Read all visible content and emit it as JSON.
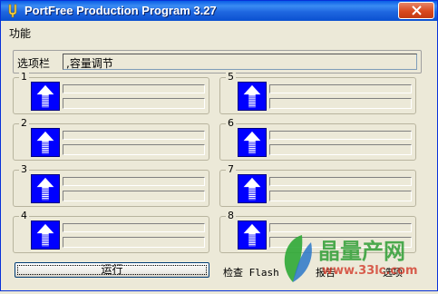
{
  "window": {
    "title": "PortFree Production Program 3.27"
  },
  "menu": {
    "items": [
      "功能"
    ]
  },
  "options": {
    "label": "选项栏",
    "value": ",容量调节"
  },
  "ports": [
    {
      "num": "1"
    },
    {
      "num": "5"
    },
    {
      "num": "2"
    },
    {
      "num": "6"
    },
    {
      "num": "3"
    },
    {
      "num": "7"
    },
    {
      "num": "4"
    },
    {
      "num": "8"
    }
  ],
  "footer": {
    "run_label": "运行",
    "check_label": "检查 Flash",
    "report_label": "报告",
    "option_label": "选项"
  },
  "watermark": {
    "site_name": "晶量产网",
    "url": "www.33lc.com",
    "colors": {
      "leaf_green": "#2fa836",
      "leaf_blue": "#2a77c9",
      "text_green": "#3aa33f",
      "url_red": "#d23a2a"
    }
  },
  "colors": {
    "titlebar": "#0a5de6",
    "port_indicator": "#0000ff",
    "close_button": "#d9491f",
    "window_bg": "#ece9d8"
  },
  "icons": {
    "app": "tuning-fork-icon",
    "close": "close-icon",
    "port": "up-arrow-icon"
  }
}
